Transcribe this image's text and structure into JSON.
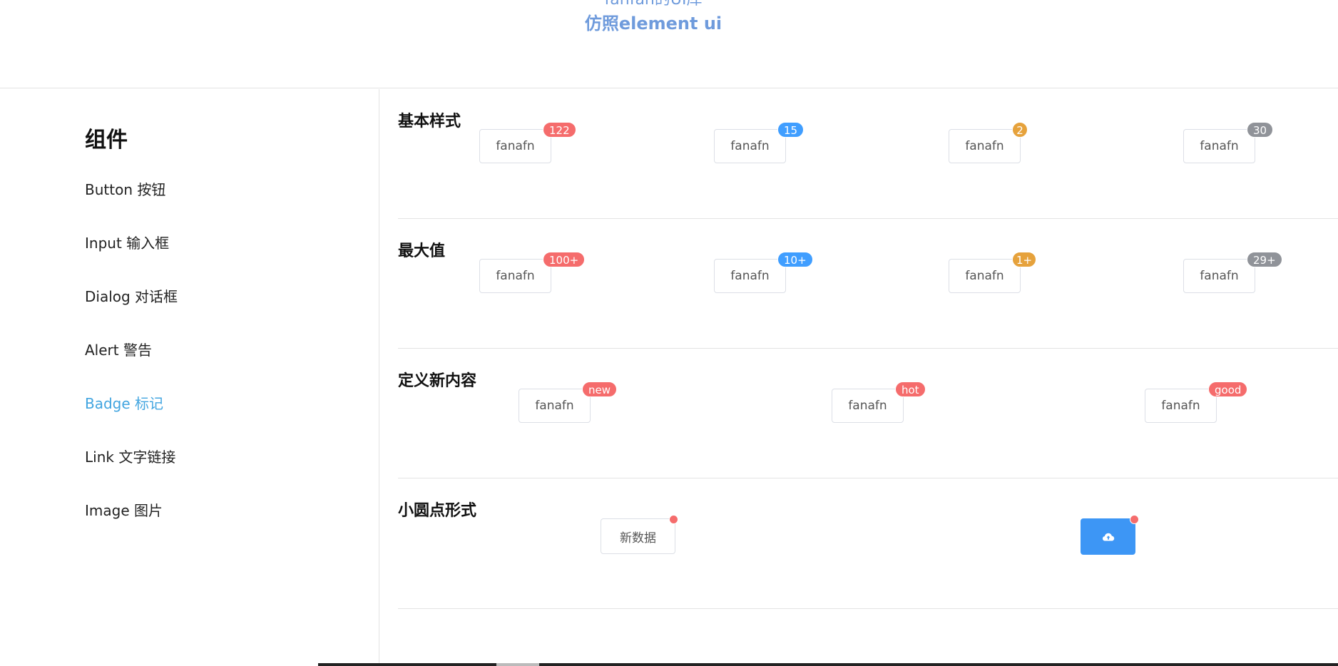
{
  "header": {
    "lib_title": "fanfan的UI库",
    "sub_title": "仿照element ui"
  },
  "sidebar": {
    "heading": "组件",
    "items": [
      {
        "label": "Button 按钮",
        "active": false
      },
      {
        "label": "Input 输入框",
        "active": false
      },
      {
        "label": "Dialog 对话框",
        "active": false
      },
      {
        "label": "Alert 警告",
        "active": false
      },
      {
        "label": "Badge 标记",
        "active": true
      },
      {
        "label": "Link 文字链接",
        "active": false
      },
      {
        "label": "Image 图片",
        "active": false
      }
    ]
  },
  "colors": {
    "danger": "#f56c6c",
    "primary": "#409eff",
    "warning": "#e6a23c",
    "info": "#909399",
    "active_nav": "#42a5e0",
    "primary_button": "#3d96f5"
  },
  "sections": {
    "basic": {
      "title": "基本样式",
      "buttons": [
        {
          "label": "fanafn",
          "badge": "122",
          "color": "#f56c6c"
        },
        {
          "label": "fanafn",
          "badge": "15",
          "color": "#409eff"
        },
        {
          "label": "fanafn",
          "badge": "2",
          "color": "#e6a23c"
        },
        {
          "label": "fanafn",
          "badge": "30",
          "color": "#909399"
        }
      ]
    },
    "max": {
      "title": "最大值",
      "buttons": [
        {
          "label": "fanafn",
          "badge": "100+",
          "color": "#f56c6c"
        },
        {
          "label": "fanafn",
          "badge": "10+",
          "color": "#409eff"
        },
        {
          "label": "fanafn",
          "badge": "1+",
          "color": "#e6a23c"
        },
        {
          "label": "fanafn",
          "badge": "29+",
          "color": "#909399"
        }
      ]
    },
    "custom": {
      "title": "定义新内容",
      "buttons": [
        {
          "label": "fanafn",
          "badge": "new",
          "color": "#f56c6c"
        },
        {
          "label": "fanafn",
          "badge": "hot",
          "color": "#f56c6c"
        },
        {
          "label": "fanafn",
          "badge": "good",
          "color": "#f56c6c"
        }
      ]
    },
    "dot": {
      "title": "小圆点形式",
      "text_button": {
        "label": "新数据",
        "dot_color": "#f56c6c"
      },
      "icon_button": {
        "icon": "cloud-upload-icon",
        "dot_color": "#f56c6c"
      }
    }
  }
}
